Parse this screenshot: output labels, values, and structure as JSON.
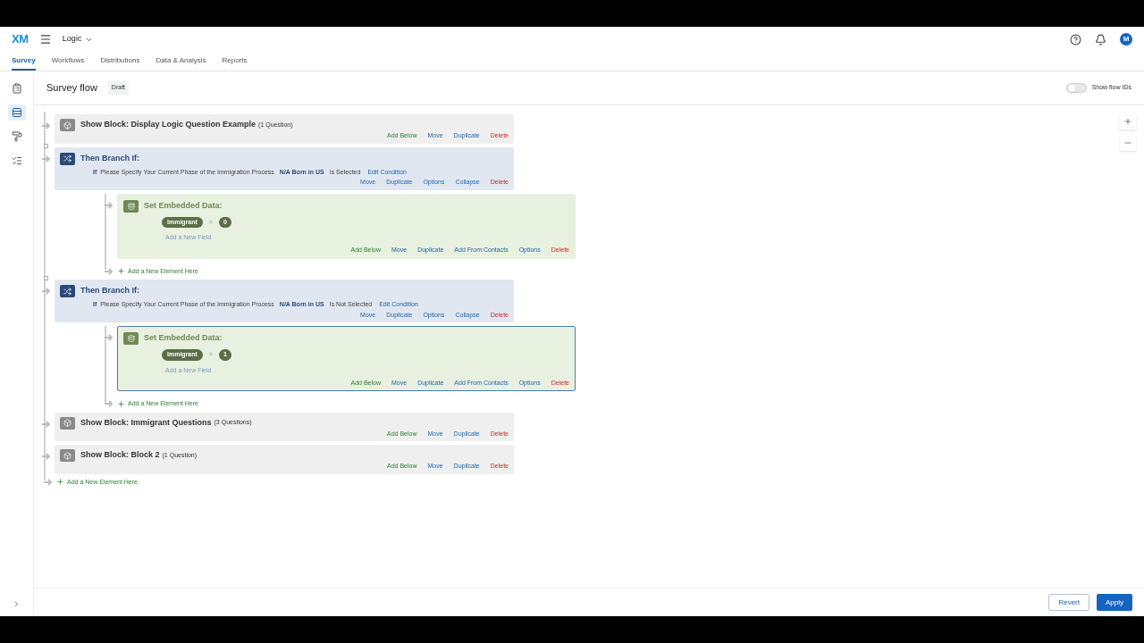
{
  "app": {
    "logo": "XM",
    "project": "Logic",
    "avatar": "M"
  },
  "nav_tabs": [
    {
      "label": "Survey",
      "selected": true
    },
    {
      "label": "Workflows",
      "selected": false
    },
    {
      "label": "Distributions",
      "selected": false
    },
    {
      "label": "Data & Analysis",
      "selected": false
    },
    {
      "label": "Reports",
      "selected": false
    }
  ],
  "sidebar": [
    {
      "kind": "questions",
      "selected": false
    },
    {
      "kind": "flow",
      "selected": true
    },
    {
      "kind": "look",
      "selected": false
    },
    {
      "kind": "options",
      "selected": false
    }
  ],
  "page": {
    "title": "Survey flow",
    "status": "Draft",
    "toggle": {
      "label": "Show flow IDs",
      "on": false
    }
  },
  "flow": [
    {
      "kind": "block",
      "title": "Show Block: Display Logic Question Example",
      "count": "(1 Question)",
      "actions": [
        {
          "label": "Add Below",
          "kind": "add"
        },
        {
          "label": "Move",
          "kind": "edit"
        },
        {
          "label": "Duplicate",
          "kind": "edit"
        },
        {
          "label": "Delete",
          "kind": "delete"
        }
      ]
    },
    {
      "kind": "branch",
      "title": "Then Branch If:",
      "condition": {
        "prefix": "If",
        "question": "Please Specify Your Current Phase of the Immigration Process",
        "choice": "N/A Born in US",
        "operator": "Is Selected",
        "link": "Edit Condition"
      },
      "actions": [
        {
          "label": "Move",
          "kind": "edit"
        },
        {
          "label": "Duplicate",
          "kind": "edit"
        },
        {
          "label": "Options",
          "kind": "edit"
        },
        {
          "label": "Collapse",
          "kind": "edit"
        },
        {
          "label": "Delete",
          "kind": "delete"
        }
      ],
      "children": [
        {
          "kind": "embedded",
          "selected": false,
          "title": "Set Embedded Data:",
          "fields": [
            {
              "name": "Immigrant",
              "op": "=",
              "value": "0"
            }
          ],
          "add_field": "Add a New Field",
          "actions": [
            {
              "label": "Add Below",
              "kind": "add"
            },
            {
              "label": "Move",
              "kind": "edit"
            },
            {
              "label": "Duplicate",
              "kind": "edit"
            },
            {
              "label": "Add From Contacts",
              "kind": "edit"
            },
            {
              "label": "Options",
              "kind": "edit"
            },
            {
              "label": "Delete",
              "kind": "delete"
            }
          ]
        },
        {
          "kind": "add",
          "label": "Add a New Element Here"
        }
      ]
    },
    {
      "kind": "branch",
      "title": "Then Branch If:",
      "condition": {
        "prefix": "If",
        "question": "Please Specify Your Current Phase of the Immigration Process",
        "choice": "N/A Born in US",
        "operator": "Is Not Selected",
        "link": "Edit Condition"
      },
      "actions": [
        {
          "label": "Move",
          "kind": "edit"
        },
        {
          "label": "Duplicate",
          "kind": "edit"
        },
        {
          "label": "Options",
          "kind": "edit"
        },
        {
          "label": "Collapse",
          "kind": "edit"
        },
        {
          "label": "Delete",
          "kind": "delete"
        }
      ],
      "children": [
        {
          "kind": "embedded",
          "selected": true,
          "title": "Set Embedded Data:",
          "fields": [
            {
              "name": "Immigrant",
              "op": "=",
              "value": "1"
            }
          ],
          "add_field": "Add a New Field",
          "actions": [
            {
              "label": "Add Below",
              "kind": "add"
            },
            {
              "label": "Move",
              "kind": "edit"
            },
            {
              "label": "Duplicate",
              "kind": "edit"
            },
            {
              "label": "Add From Contacts",
              "kind": "edit"
            },
            {
              "label": "Options",
              "kind": "edit"
            },
            {
              "label": "Delete",
              "kind": "delete"
            }
          ]
        },
        {
          "kind": "add",
          "label": "Add a New Element Here"
        }
      ]
    },
    {
      "kind": "block",
      "title": "Show Block: Immigrant Questions",
      "count": "(3 Questions)",
      "actions": [
        {
          "label": "Add Below",
          "kind": "add"
        },
        {
          "label": "Move",
          "kind": "edit"
        },
        {
          "label": "Duplicate",
          "kind": "edit"
        },
        {
          "label": "Delete",
          "kind": "delete"
        }
      ]
    },
    {
      "kind": "block",
      "title": "Show Block: Block 2",
      "count": "(1 Question)",
      "actions": [
        {
          "label": "Add Below",
          "kind": "add"
        },
        {
          "label": "Move",
          "kind": "edit"
        },
        {
          "label": "Duplicate",
          "kind": "edit"
        },
        {
          "label": "Delete",
          "kind": "delete"
        }
      ]
    },
    {
      "kind": "add",
      "label": "Add a New Element Here"
    }
  ],
  "footer": [
    {
      "label": "Revert",
      "kind": "secondary"
    },
    {
      "label": "Apply",
      "kind": "primary"
    }
  ]
}
